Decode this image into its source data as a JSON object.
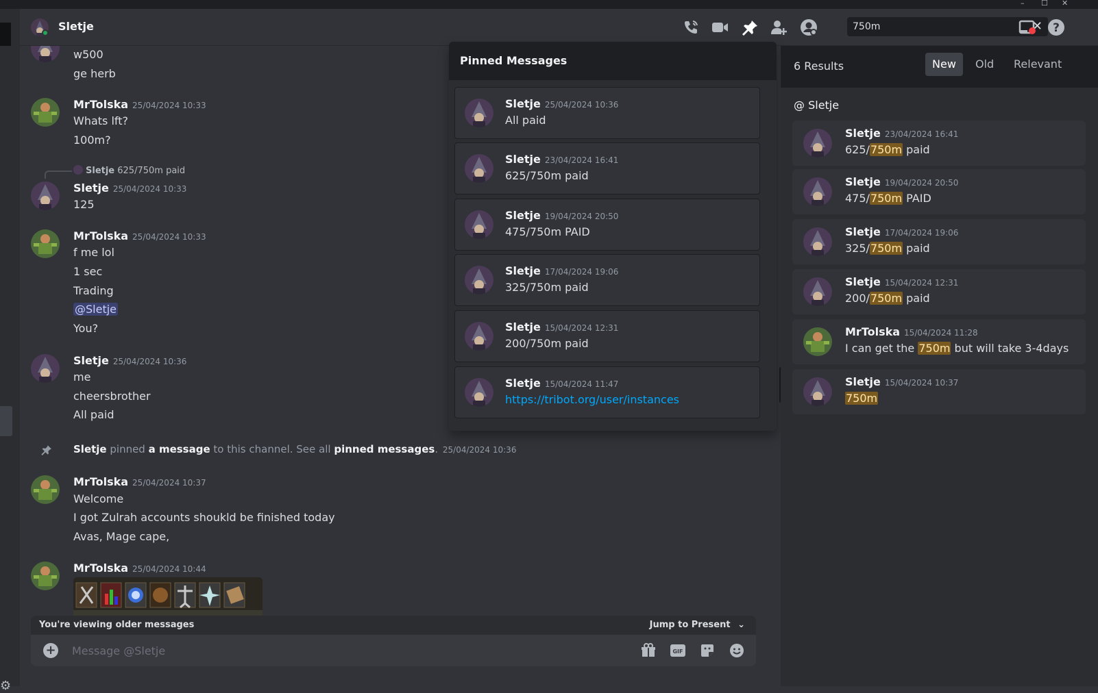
{
  "window": {
    "minimize": "–",
    "maximize": "☐",
    "close": "✕"
  },
  "header": {
    "name": "Sletje",
    "search_value": "750m",
    "icons": [
      "phone-call-icon",
      "video-camera-icon",
      "pin-icon",
      "add-friend-icon",
      "user-profile-icon",
      "inbox-icon",
      "help-icon"
    ]
  },
  "chat": {
    "messages": [
      {
        "lines": [
          "w500",
          "ge herb"
        ]
      },
      {
        "user": "MrTolska",
        "time": "25/04/2024 10:33",
        "lines": [
          "Whats lft?",
          "100m?"
        ]
      },
      {
        "reply_user": "Sletje",
        "reply_text": "625/750m paid",
        "user": "Sletje",
        "time": "25/04/2024 10:33",
        "lines": [
          "125"
        ]
      },
      {
        "user": "MrTolska",
        "time": "25/04/2024 10:33",
        "lines": [
          "f me lol",
          "1 sec",
          "Trading",
          "@Sletje",
          "You?"
        ]
      },
      {
        "user": "Sletje",
        "time": "25/04/2024 10:36",
        "lines": [
          "me",
          "cheersbrother",
          "All paid"
        ]
      },
      {
        "user": "MrTolska",
        "time": "25/04/2024 10:37",
        "lines": [
          "Welcome",
          "I got Zulrah accounts shoukld be finished today",
          "Avas, Mage cape,"
        ]
      },
      {
        "user": "MrTolska",
        "time": "25/04/2024 10:44"
      }
    ],
    "system": {
      "user": "Sletje",
      "t1": " pinned ",
      "link1": "a message",
      "t2": " to this channel. See all ",
      "link2": "pinned messages",
      "t3": ".",
      "time": "25/04/2024 10:36"
    },
    "older_notice": "You're viewing older messages",
    "jump": "Jump to Present",
    "composer_placeholder": "Message @Sletje"
  },
  "pinned": {
    "title": "Pinned Messages",
    "items": [
      {
        "user": "Sletje",
        "time": "25/04/2024 10:36",
        "text": "All paid"
      },
      {
        "user": "Sletje",
        "time": "23/04/2024 16:41",
        "text": "625/750m paid"
      },
      {
        "user": "Sletje",
        "time": "19/04/2024 20:50",
        "text": "475/750m PAID"
      },
      {
        "user": "Sletje",
        "time": "17/04/2024 19:06",
        "text": "325/750m paid"
      },
      {
        "user": "Sletje",
        "time": "15/04/2024 12:31",
        "text": "200/750m paid"
      },
      {
        "user": "Sletje",
        "time": "15/04/2024 11:47",
        "text": "https://tribot.org/user/instances"
      }
    ]
  },
  "results": {
    "count": "6 Results",
    "tabs": [
      "New",
      "Old",
      "Relevant"
    ],
    "section": "@ Sletje",
    "items": [
      {
        "user": "Sletje",
        "time": "23/04/2024 16:41",
        "pre": "625/",
        "hl": "750m",
        "post": " paid"
      },
      {
        "user": "Sletje",
        "time": "19/04/2024 20:50",
        "pre": "475/",
        "hl": "750m",
        "post": " PAID"
      },
      {
        "user": "Sletje",
        "time": "17/04/2024 19:06",
        "pre": "325/",
        "hl": "750m",
        "post": " paid"
      },
      {
        "user": "Sletje",
        "time": "15/04/2024 12:31",
        "pre": "200/",
        "hl": "750m",
        "post": " paid"
      },
      {
        "user": "MrTolska",
        "time": "15/04/2024 11:28",
        "pre": "I can get the ",
        "hl": "750m",
        "post": " but will take 3-4days"
      },
      {
        "user": "Sletje",
        "time": "15/04/2024 10:37",
        "pre": "",
        "hl": "750m",
        "post": ""
      }
    ]
  },
  "colors": {
    "background": "#313338",
    "panel": "#2b2d31",
    "accent_link": "#00a8fc",
    "highlight": "#7a5a1f",
    "online": "#23a55a"
  }
}
